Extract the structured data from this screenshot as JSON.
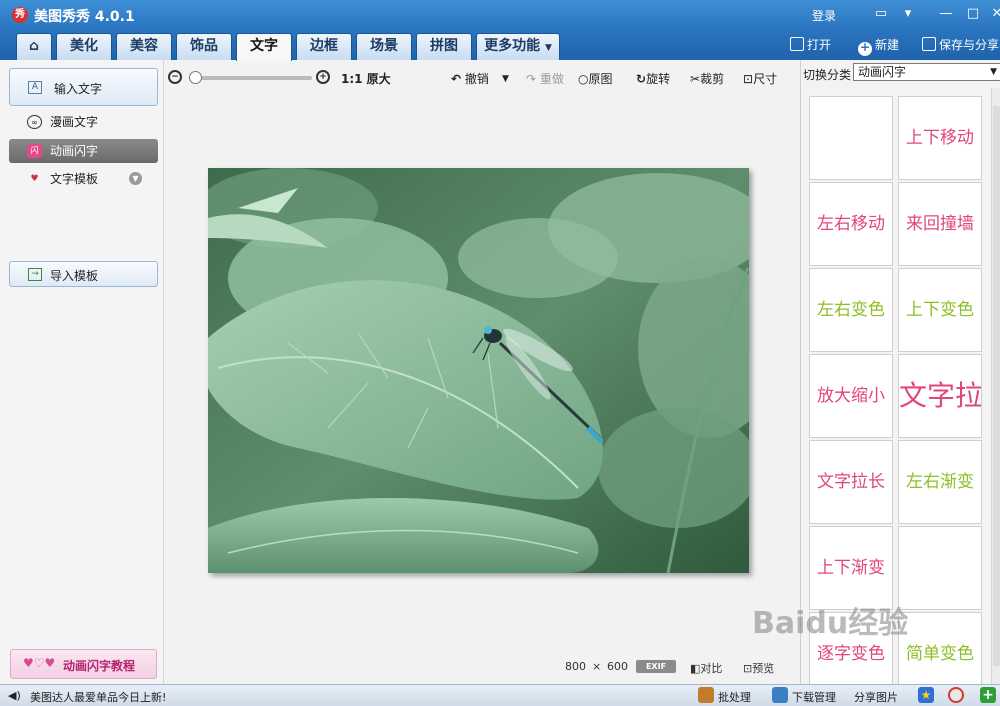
{
  "window": {
    "app_title": "美图秀秀 4.0.1",
    "logo_text": "秀",
    "login_label": "登录"
  },
  "tabs": [
    "美化",
    "美容",
    "饰品",
    "文字",
    "边框",
    "场景",
    "拼图"
  ],
  "more_label": "更多功能",
  "top_actions": {
    "open": "打开",
    "new": "新建",
    "save_share": "保存与分享"
  },
  "left_panel": {
    "input_text": "输入文字",
    "items": [
      "漫画文字",
      "动画闪字",
      "文字模板"
    ],
    "import_template": "导入模板",
    "tutorial": "动画闪字教程"
  },
  "toolbar": {
    "original_size": "1:1 原大",
    "undo": "撤销",
    "redo": "重做",
    "original": "原图",
    "rotate": "旋转",
    "crop": "裁剪",
    "size": "尺寸"
  },
  "image": {
    "width": "800",
    "times": "×",
    "height": "600",
    "exif": "EXIF",
    "compare": "对比",
    "preview": "预览"
  },
  "right_panel": {
    "category_label": "切换分类",
    "category_value": "动画闪字",
    "effects": [
      {
        "label": "",
        "color": "#e0457e"
      },
      {
        "label": "上下移动",
        "color": "#e0457e"
      },
      {
        "label": "左右移动",
        "color": "#e0457e"
      },
      {
        "label": "来回撞墙",
        "color": "#e0457e"
      },
      {
        "label": "左右变色",
        "color": "#8cbf26"
      },
      {
        "label": "上下变色",
        "color": "#8cbf26"
      },
      {
        "label": "放大缩小",
        "color": "#e0457e"
      },
      {
        "label": "文字拉高",
        "color": "#e0457e"
      },
      {
        "label": "文字拉长",
        "color": "#e0457e"
      },
      {
        "label": "左右渐变",
        "color": "#8cbf26"
      },
      {
        "label": "上下渐变",
        "color": "#e0457e"
      },
      {
        "label": "",
        "color": "#e0457e"
      },
      {
        "label": "逐字变色",
        "color": "#e0457e"
      },
      {
        "label": "简单变色",
        "color": "#8cbf26"
      }
    ]
  },
  "status_bar": {
    "news": "美图达人最爱单品今日上新!",
    "batch": "批处理",
    "download": "下载管理",
    "share": "分享图片"
  },
  "watermark": "Baidu经验"
}
